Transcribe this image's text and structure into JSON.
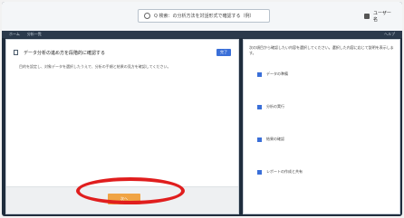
{
  "header": {
    "title": "Q 検索：の分析方法を対話形式で確認する（例）",
    "user": "ユーザー名"
  },
  "nav": {
    "items": [
      "ホーム",
      "分析一覧"
    ],
    "right": "ヘルプ"
  },
  "left_panel": {
    "title": "データ分析の進め方を段階的に確認する",
    "badge": "完了",
    "description": "目的を設定し、対象データを選択したうえで、分析の手順と結果の見方を確認してください。",
    "action_button": "次へ"
  },
  "right_panel": {
    "description": "次の項目から確認したい内容を選択してください。選択した内容に応じて説明を表示します。",
    "options": [
      "データの準備",
      "分析の実行",
      "結果の確認",
      "レポートの作成と共有"
    ]
  },
  "colors": {
    "accent": "#3a6fd8",
    "button": "#f0a445",
    "highlight": "#e01e1e",
    "window": "#1f2d3d"
  }
}
